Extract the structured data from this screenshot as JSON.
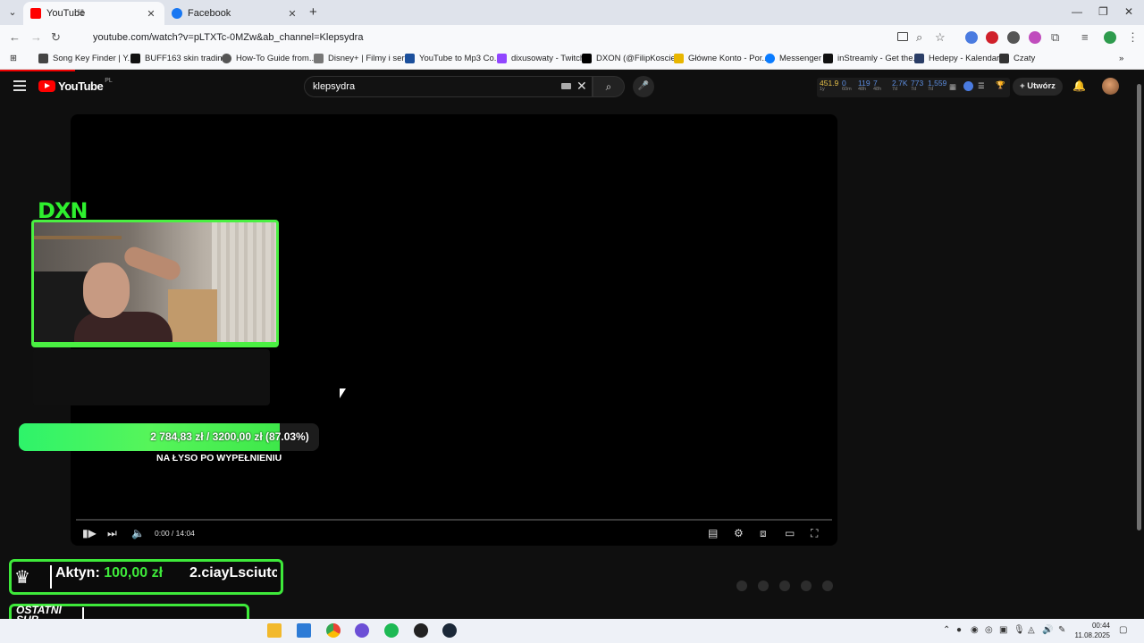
{
  "browser": {
    "tabs": [
      {
        "title": "YouTube",
        "active": true
      },
      {
        "title": "Facebook",
        "active": false
      }
    ],
    "url": "youtube.com/watch?v=pLTXTc-0MZw&ab_channel=Klepsydra",
    "bookmarks": [
      "Song Key Finder | Y...",
      "BUFF163 skin tradin...",
      "How-To Guide from...",
      "Disney+ | Filmy i ser...",
      "YouTube to Mp3 Co...",
      "dixusowaty - Twitch",
      "DXON (@FilipKoscie...",
      "Główne Konto - Por...",
      "Messenger",
      "inStreamly - Get the...",
      "Hedepy - Kalendarz",
      "Czaty"
    ]
  },
  "youtube": {
    "logo_text": "YouTube",
    "country_code": "PL",
    "search_value": "klepsydra",
    "stats": {
      "s1": {
        "value": "451.9",
        "sub": "1y"
      },
      "s2": {
        "value": "0",
        "sub": "60m"
      },
      "s3": {
        "value": "119",
        "sub": "48h"
      },
      "s4": {
        "value": "7",
        "sub": "48h"
      },
      "s5": {
        "value": "2.7K",
        "sub": "7d"
      },
      "s6": {
        "value": "773",
        "sub": "7d"
      },
      "s7": {
        "value": "1,559",
        "sub": "7d"
      }
    },
    "create_label": "Utwórz",
    "player": {
      "time": "0:00 / 14:04"
    }
  },
  "overlay": {
    "brand": "DXN",
    "goal": {
      "text": "2 784,83 zł  /  3200,00 zł (87.03%)",
      "progress_fraction": 0.8703,
      "label": "NA ŁYSO PO WYPEŁNIENIU"
    },
    "top_donation": {
      "label": "Aktyn:",
      "amount": "100,00 zł",
      "second": "2.ciayLsciutc"
    },
    "last_sub_label_1": "OSTATNI",
    "last_sub_label_2": "SUB"
  },
  "taskbar": {
    "time": "00:44",
    "date": "11.08.2025"
  },
  "colors": {
    "accent_green": "#3ee93a",
    "youtube_red": "#ff0000",
    "stat_blue": "#5d8ee0",
    "stat_yellow": "#e7c24b"
  }
}
